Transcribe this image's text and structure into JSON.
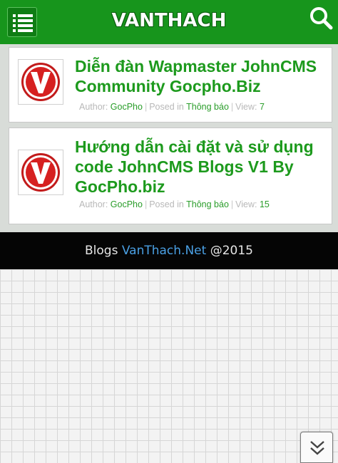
{
  "header": {
    "logo_text": "VANTHACH"
  },
  "posts": [
    {
      "title": "Diễn đàn Wapmaster JohnCMS Community Gocpho.Biz",
      "author_label": "Author:",
      "author": "GocPho",
      "separator": "|",
      "posted_label": "Posed in",
      "category": "Thông báo",
      "view_label": "View:",
      "views": "7"
    },
    {
      "title": "Hướng dẫn cài đặt và sử dụng code JohnCMS Blogs V1 By GocPho.biz",
      "author_label": "Author:",
      "author": "GocPho",
      "separator": "|",
      "posted_label": "Posed in",
      "category": "Thông báo",
      "view_label": "View:",
      "views": "15"
    }
  ],
  "footer": {
    "prefix": "Blogs",
    "brand": "VanThach.Net",
    "suffix": "@2015"
  },
  "icons": {
    "menu": "list-icon",
    "search": "search-icon",
    "avatar": "v-logo-icon",
    "scroll": "double-chevron-down-icon"
  },
  "colors": {
    "header": "#17951c",
    "title": "#1d9a1d",
    "footer_brand": "#4aa0e4",
    "avatar_red": "#d62020"
  }
}
